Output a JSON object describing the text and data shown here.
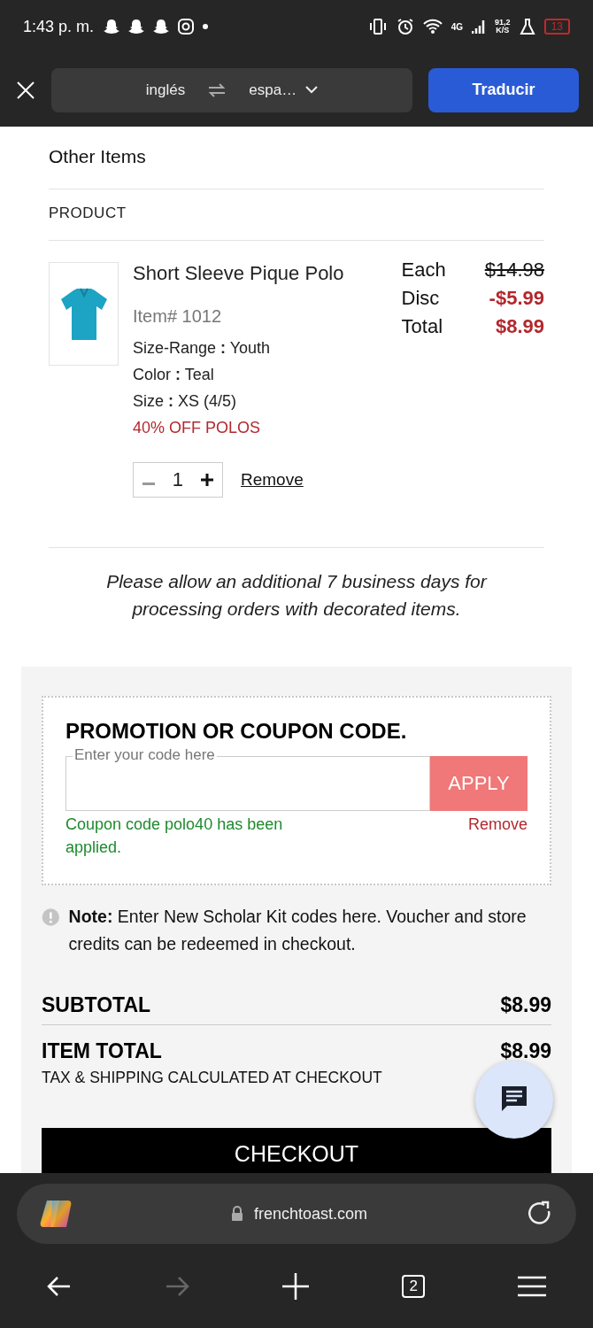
{
  "status_bar": {
    "time": "1:43 p. m.",
    "network": "4G",
    "speed": "91,2",
    "speed_unit": "K/S",
    "battery": "13"
  },
  "translate_bar": {
    "source": "inglés",
    "target": "espa…",
    "button": "Traducir"
  },
  "cart": {
    "section_title": "Other Items",
    "column_header": "PRODUCT",
    "items": [
      {
        "name": "Short Sleeve Pique Polo",
        "item_no": "Item# 1012",
        "attributes": [
          "Size-Range **:** Youth",
          "Color **:** Teal",
          "Size **:** XS (4/5)"
        ],
        "promo": "40% OFF POLOS",
        "quantity": "1",
        "remove": "Remove",
        "prices": [
          {
            "label": "Each",
            "value": "$14.98",
            "kind": "original"
          },
          {
            "label": "Disc",
            "value": "-$5.99",
            "kind": "discount"
          },
          {
            "label": "Total",
            "value": "$8.99",
            "kind": "total"
          }
        ]
      }
    ],
    "notice": "Please allow an additional 7 business days for processing orders with decorated items."
  },
  "coupon": {
    "title": "PROMOTION OR COUPON CODE.",
    "placeholder": "Enter your code here",
    "button": "APPLY",
    "message": "Coupon code polo40 has been applied.",
    "remove": "Remove"
  },
  "note": "**Note:** Enter New Scholar Kit codes here. Voucher and store credits can be redeemed in checkout.",
  "summary": {
    "subtotal_label": "SUBTOTAL",
    "subtotal": "$8.99",
    "item_total_label": "ITEM TOTAL",
    "item_total": "$8.99",
    "tax_note": "TAX & SHIPPING CALCULATED AT CHECKOUT",
    "checkout": "CHECKOUT"
  },
  "browser": {
    "url": "frenchtoast.com",
    "tab_count": "2",
    "back_disabled": false,
    "forward_disabled": true
  }
}
